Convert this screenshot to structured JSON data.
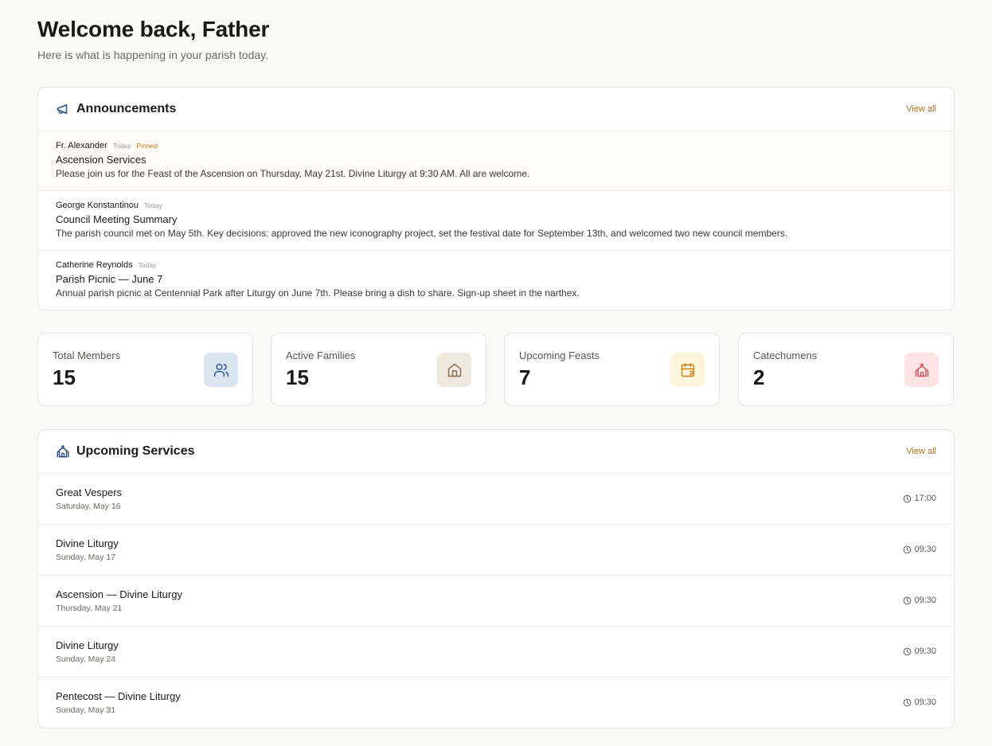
{
  "header": {
    "title": "Welcome back, Father",
    "subtitle": "Here is what is happening in your parish today."
  },
  "announcements": {
    "title": "Announcements",
    "view_all": "View all",
    "icon": "megaphone-icon",
    "items": [
      {
        "author": "Fr. Alexander",
        "when": "Today",
        "pinned_label": "Pinned",
        "title": "Ascension Services",
        "body": "Please join us for the Feast of the Ascension on Thursday, May 21st. Divine Liturgy at 9:30 AM. All are welcome."
      },
      {
        "author": "George Konstantinou",
        "when": "Today",
        "title": "Council Meeting Summary",
        "body": "The parish council met on May 5th. Key decisions: approved the new iconography project, set the festival date for September 13th, and welcomed two new council members."
      },
      {
        "author": "Catherine Reynolds",
        "when": "Today",
        "title": "Parish Picnic — June 7",
        "body": "Annual parish picnic at Centennial Park after Liturgy on June 7th. Please bring a dish to share. Sign-up sheet in the narthex."
      }
    ]
  },
  "stats": [
    {
      "label": "Total Members",
      "value": "15",
      "icon": "users-icon",
      "icon_bg": "#dbe5f1",
      "icon_color": "#2f5a9a"
    },
    {
      "label": "Active Families",
      "value": "15",
      "icon": "home-icon",
      "icon_bg": "#efe8df",
      "icon_color": "#8a6d4f"
    },
    {
      "label": "Upcoming Feasts",
      "value": "7",
      "icon": "calendar-heart-icon",
      "icon_bg": "#fdf6dc",
      "icon_color": "#c5841a"
    },
    {
      "label": "Catechumens",
      "value": "2",
      "icon": "church-icon",
      "icon_bg": "#fbe3e4",
      "icon_color": "#cf5a66"
    }
  ],
  "services": {
    "title": "Upcoming Services",
    "view_all": "View all",
    "icon": "church-icon",
    "items": [
      {
        "name": "Great Vespers",
        "date": "Saturday, May 16",
        "time": "17:00"
      },
      {
        "name": "Divine Liturgy",
        "date": "Sunday, May 17",
        "time": "09:30"
      },
      {
        "name": "Ascension — Divine Liturgy",
        "date": "Thursday, May 21",
        "time": "09:30"
      },
      {
        "name": "Divine Liturgy",
        "date": "Sunday, May 24",
        "time": "09:30"
      },
      {
        "name": "Pentecost — Divine Liturgy",
        "date": "Sunday, May 31",
        "time": "09:30"
      }
    ]
  },
  "colors": {
    "accent": "#a8721e",
    "pinned": "#c07e12",
    "heading_icon": "#2f4f86"
  }
}
